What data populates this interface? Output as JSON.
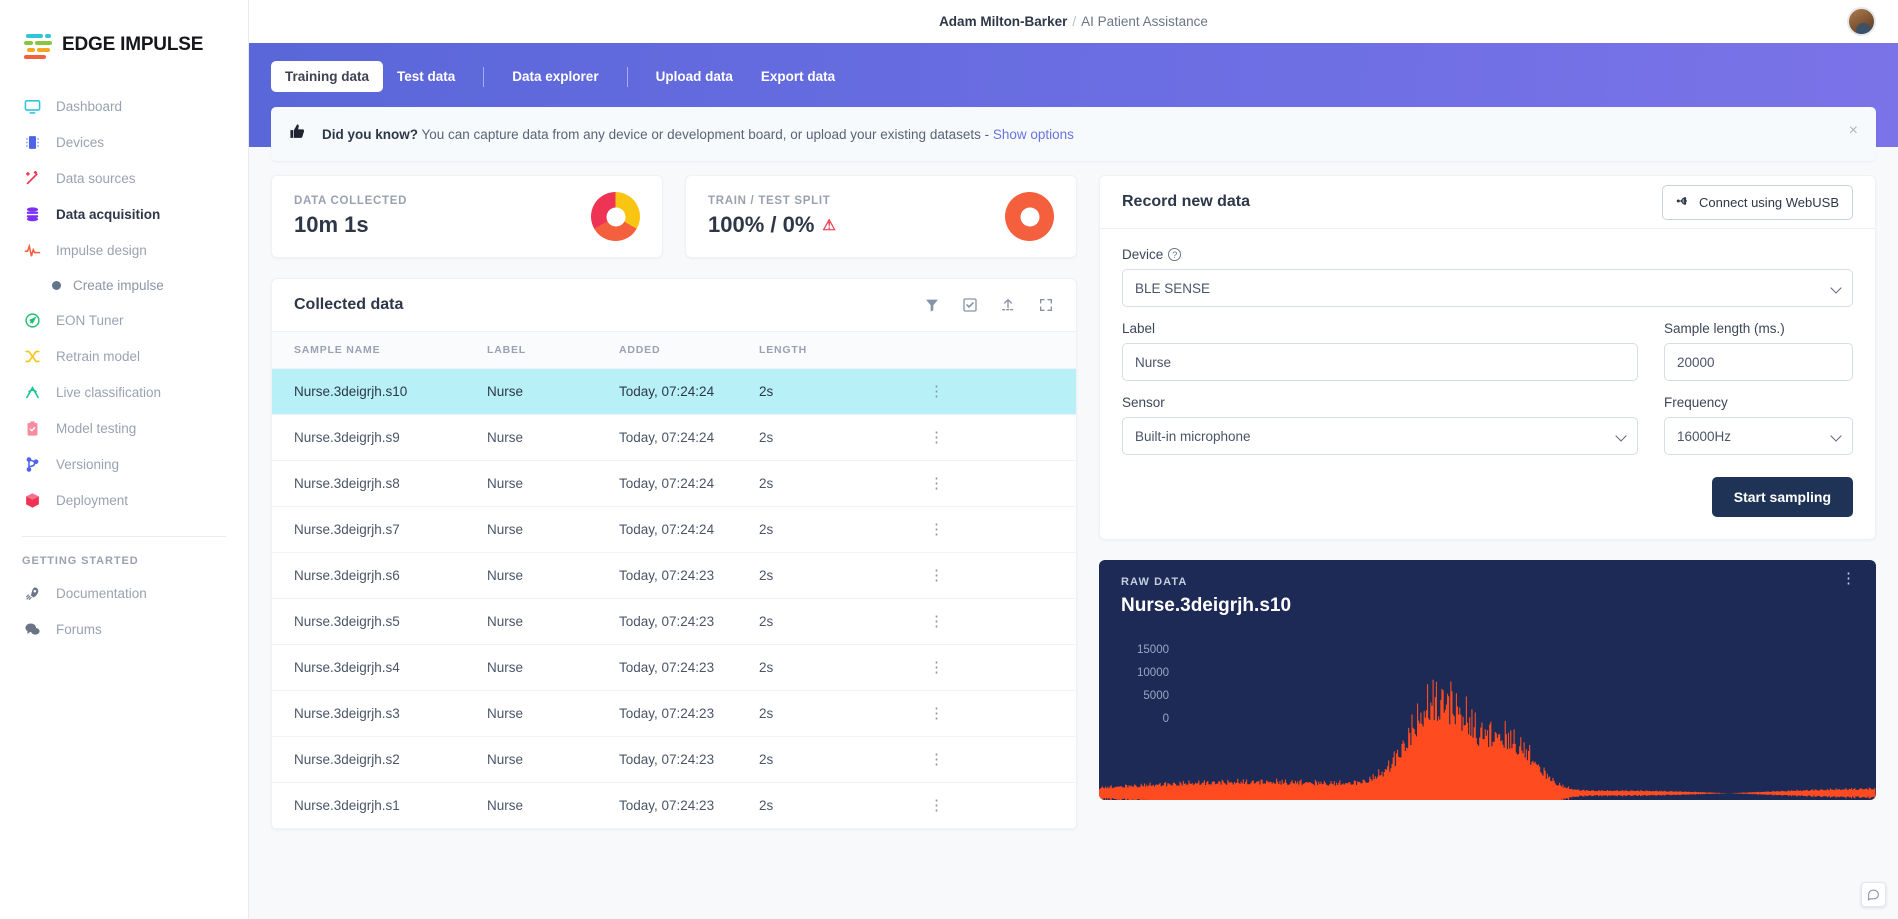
{
  "brand": {
    "name": "EDGE IMPULSE"
  },
  "header": {
    "user": "Adam Milton-Barker",
    "separator": "/",
    "project": "AI Patient Assistance",
    "avatar_alt": "user-avatar"
  },
  "sidebar": {
    "items": [
      {
        "label": "Dashboard",
        "icon": "monitor-icon"
      },
      {
        "label": "Devices",
        "icon": "chip-icon"
      },
      {
        "label": "Data sources",
        "icon": "wand-icon"
      },
      {
        "label": "Data acquisition",
        "icon": "database-icon"
      },
      {
        "label": "Impulse design",
        "icon": "pulse-icon"
      }
    ],
    "sub_item": {
      "label": "Create impulse",
      "icon": "dot-icon"
    },
    "items2": [
      {
        "label": "EON Tuner",
        "icon": "compass-icon"
      },
      {
        "label": "Retrain model",
        "icon": "shuffle-icon"
      },
      {
        "label": "Live classification",
        "icon": "antenna-icon"
      },
      {
        "label": "Model testing",
        "icon": "clipboard-check-icon"
      },
      {
        "label": "Versioning",
        "icon": "branch-icon"
      },
      {
        "label": "Deployment",
        "icon": "box-icon"
      }
    ],
    "section_title": "GETTING STARTED",
    "items3": [
      {
        "label": "Documentation",
        "icon": "rocket-icon"
      },
      {
        "label": "Forums",
        "icon": "chat-icon"
      }
    ]
  },
  "tabs": [
    {
      "label": "Training data",
      "active": true
    },
    {
      "label": "Test data",
      "active": false
    },
    {
      "label": "Data explorer",
      "active": false
    },
    {
      "label": "Upload data",
      "active": false
    },
    {
      "label": "Export data",
      "active": false
    }
  ],
  "banner": {
    "icon": "thumbs-up-icon",
    "bold": "Did you know?",
    "text": " You can capture data from any device or development board, or upload your existing datasets - ",
    "link": "Show options",
    "close": "×"
  },
  "stats": [
    {
      "label": "DATA COLLECTED",
      "value": "10m 1s",
      "donut": "conic-gradient(#f9c513 0deg 120deg, #f4603e 120deg 240deg, #ef3355 240deg 360deg)"
    },
    {
      "label": "TRAIN / TEST SPLIT",
      "value": "100% / 0%",
      "warning": "⚠",
      "donut": "conic-gradient(#f4603e 0deg 360deg)"
    }
  ],
  "collected": {
    "title": "Collected data",
    "tools": [
      "filter-icon",
      "select-all-icon",
      "upload-icon",
      "expand-icon"
    ],
    "columns": [
      "SAMPLE NAME",
      "LABEL",
      "ADDED",
      "LENGTH"
    ],
    "rows": [
      {
        "name": "Nurse.3deigrjh.s10",
        "label": "Nurse",
        "added": "Today, 07:24:24",
        "length": "2s",
        "selected": true
      },
      {
        "name": "Nurse.3deigrjh.s9",
        "label": "Nurse",
        "added": "Today, 07:24:24",
        "length": "2s",
        "selected": false
      },
      {
        "name": "Nurse.3deigrjh.s8",
        "label": "Nurse",
        "added": "Today, 07:24:24",
        "length": "2s",
        "selected": false
      },
      {
        "name": "Nurse.3deigrjh.s7",
        "label": "Nurse",
        "added": "Today, 07:24:24",
        "length": "2s",
        "selected": false
      },
      {
        "name": "Nurse.3deigrjh.s6",
        "label": "Nurse",
        "added": "Today, 07:24:23",
        "length": "2s",
        "selected": false
      },
      {
        "name": "Nurse.3deigrjh.s5",
        "label": "Nurse",
        "added": "Today, 07:24:23",
        "length": "2s",
        "selected": false
      },
      {
        "name": "Nurse.3deigrjh.s4",
        "label": "Nurse",
        "added": "Today, 07:24:23",
        "length": "2s",
        "selected": false
      },
      {
        "name": "Nurse.3deigrjh.s3",
        "label": "Nurse",
        "added": "Today, 07:24:23",
        "length": "2s",
        "selected": false
      },
      {
        "name": "Nurse.3deigrjh.s2",
        "label": "Nurse",
        "added": "Today, 07:24:23",
        "length": "2s",
        "selected": false
      },
      {
        "name": "Nurse.3deigrjh.s1",
        "label": "Nurse",
        "added": "Today, 07:24:23",
        "length": "2s",
        "selected": false
      }
    ],
    "kebab": "⋮"
  },
  "record": {
    "title": "Record new data",
    "webusb_button": "Connect using WebUSB",
    "webusb_icon": "usb-icon",
    "device_label": "Device",
    "device_help_icon": "question-icon",
    "device_value": "BLE SENSE",
    "label_label": "Label",
    "label_value": "Nurse",
    "sample_length_label": "Sample length (ms.)",
    "sample_length_value": "20000",
    "sensor_label": "Sensor",
    "sensor_value": "Built-in microphone",
    "frequency_label": "Frequency",
    "frequency_value": "16000Hz",
    "start_button": "Start sampling"
  },
  "raw": {
    "eyebrow": "RAW DATA",
    "title": "Nurse.3deigrjh.s10",
    "kebab": "⋮",
    "yticks": [
      "15000",
      "10000",
      "5000",
      "0"
    ],
    "waveform_color": "#ff4b1f"
  },
  "chat_widget": {
    "icon": "chat-bubble-icon"
  },
  "colors": {
    "accent_purple": "#6b6ee2",
    "dark_navy": "#1e3356",
    "selection_cyan": "#b8f0f7",
    "orange": "#f4603e",
    "red": "#ef3355",
    "yellow": "#f9c513"
  }
}
